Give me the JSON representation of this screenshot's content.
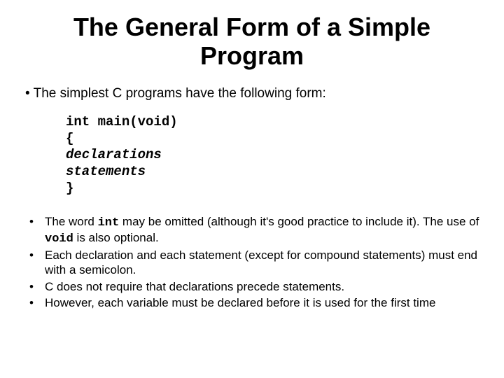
{
  "title": "The General Form of a Simple Program",
  "intro": "The simplest C programs have the following form:",
  "code": {
    "l1": "int main(void)",
    "l2": "{",
    "l3": "declarations",
    "l4": "statements",
    "l5": "}"
  },
  "points": {
    "p1a": "The word ",
    "p1kw1": "int",
    "p1b": " may be omitted (although it's good practice to include it). The use of ",
    "p1kw2": "void",
    "p1c": " is also optional.",
    "p2": "Each declaration and each statement (except for compound statements) must end with a semicolon.",
    "p3": "C does not require that declarations precede statements.",
    "p4": "However, each variable must be declared before it is used for the first time"
  }
}
